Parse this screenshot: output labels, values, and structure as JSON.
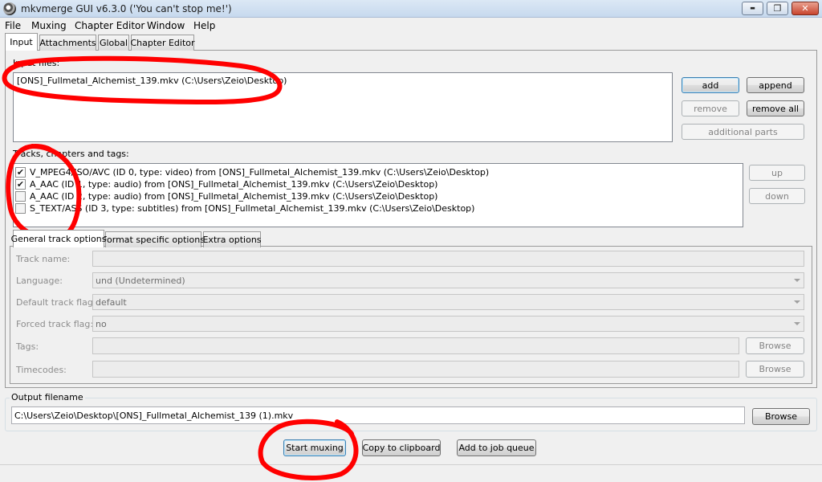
{
  "window": {
    "title": "mkvmerge GUI v6.3.0 ('You can't stop me!')",
    "min_glyph": "▬",
    "max_glyph": "❐",
    "close_glyph": "✕"
  },
  "menu": [
    "File",
    "Muxing",
    "Chapter Editor",
    "Window",
    "Help"
  ],
  "tabs": [
    "Input",
    "Attachments",
    "Global",
    "Chapter Editor"
  ],
  "input": {
    "files_label": "Input files:",
    "files": [
      "[ONS]_Fullmetal_Alchemist_139.mkv (C:\\Users\\Zeio\\Desktop)"
    ],
    "buttons": {
      "add": "add",
      "append": "append",
      "remove": "remove",
      "remove_all": "remove all",
      "additional_parts": "additional parts"
    },
    "tracks_label": "Tracks, chapters and tags:",
    "tracks": [
      {
        "checked": true,
        "text": "V_MPEG4/ISO/AVC (ID 0, type: video) from [ONS]_Fullmetal_Alchemist_139.mkv (C:\\Users\\Zeio\\Desktop)"
      },
      {
        "checked": true,
        "text": "A_AAC (ID 1, type: audio) from [ONS]_Fullmetal_Alchemist_139.mkv (C:\\Users\\Zeio\\Desktop)"
      },
      {
        "checked": false,
        "text": "A_AAC (ID 2, type: audio) from [ONS]_Fullmetal_Alchemist_139.mkv (C:\\Users\\Zeio\\Desktop)"
      },
      {
        "checked": false,
        "text": "S_TEXT/ASS (ID 3, type: subtitles) from [ONS]_Fullmetal_Alchemist_139.mkv (C:\\Users\\Zeio\\Desktop)"
      }
    ],
    "up": "up",
    "down": "down",
    "check_glyph": "✔"
  },
  "subtabs": [
    "General track options",
    "Format specific options",
    "Extra options"
  ],
  "track_options": {
    "track_name_label": "Track name:",
    "language_label": "Language:",
    "language_value": "und (Undetermined)",
    "default_flag_label": "Default track flag:",
    "default_flag_value": "default",
    "forced_flag_label": "Forced track flag:",
    "forced_flag_value": "no",
    "tags_label": "Tags:",
    "timecodes_label": "Timecodes:",
    "browse": "Browse"
  },
  "output": {
    "label": "Output filename",
    "value": "C:\\Users\\Zeio\\Desktop\\[ONS]_Fullmetal_Alchemist_139 (1).mkv",
    "browse": "Browse"
  },
  "actions": {
    "start": "Start muxing",
    "copy": "Copy to clipboard",
    "queue": "Add to job queue"
  },
  "colors": {
    "annotation": "#ff0000",
    "titlebar": "#c7d9ee"
  }
}
